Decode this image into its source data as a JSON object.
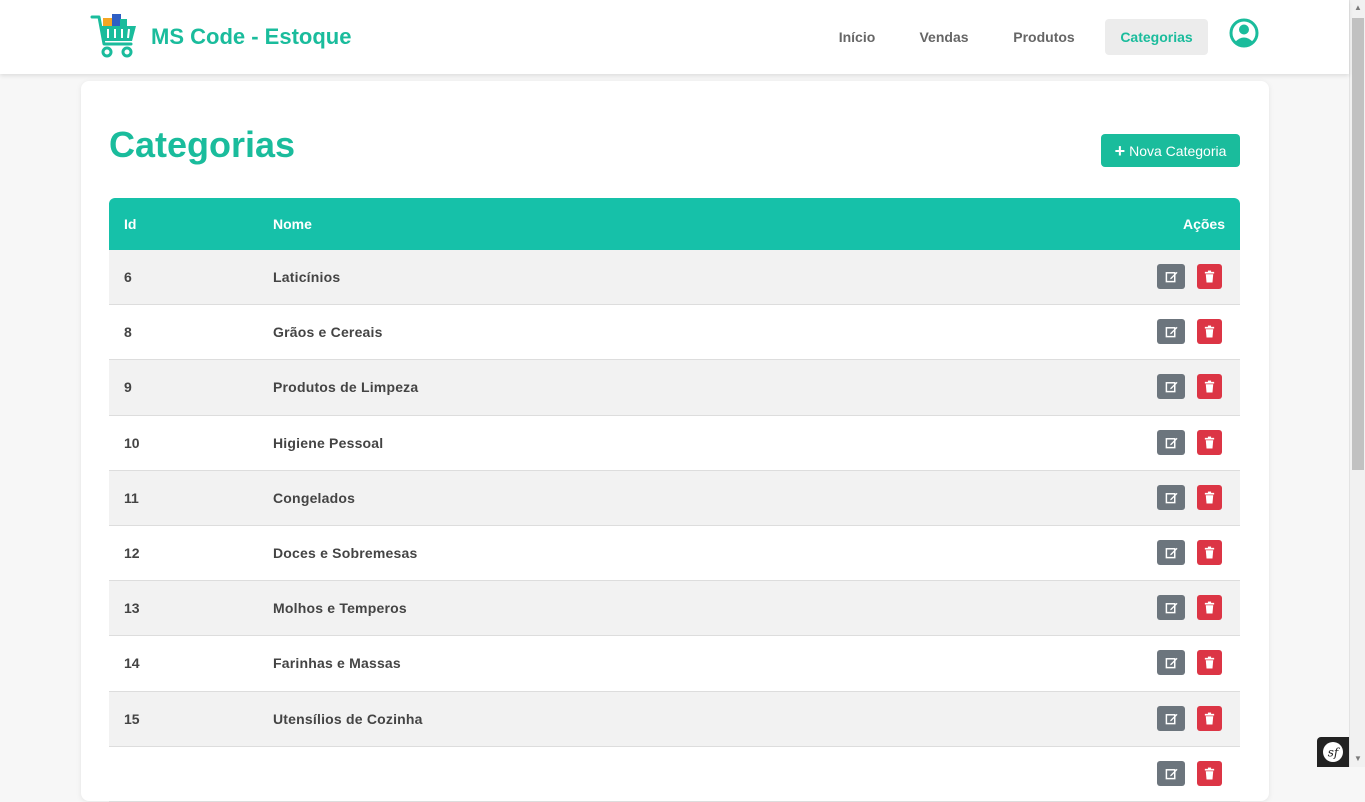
{
  "app": {
    "title": "MS Code - Estoque",
    "brand_color": "#1abc9c"
  },
  "nav": {
    "items": [
      {
        "label": "Início",
        "active": false
      },
      {
        "label": "Vendas",
        "active": false
      },
      {
        "label": "Produtos",
        "active": false
      },
      {
        "label": "Categorias",
        "active": true
      }
    ],
    "user_icon": "user-circle-icon"
  },
  "page": {
    "title": "Categorias",
    "new_button_label": "Nova Categoria",
    "new_button_icon": "plus-icon"
  },
  "table": {
    "header_color": "#16c1a9",
    "columns": [
      "Id",
      "Nome",
      "Ações"
    ],
    "rows": [
      {
        "id": "6",
        "nome": "Laticínios"
      },
      {
        "id": "8",
        "nome": "Grãos e Cereais"
      },
      {
        "id": "9",
        "nome": "Produtos de Limpeza"
      },
      {
        "id": "10",
        "nome": "Higiene Pessoal"
      },
      {
        "id": "11",
        "nome": "Congelados"
      },
      {
        "id": "12",
        "nome": "Doces e Sobremesas"
      },
      {
        "id": "13",
        "nome": "Molhos e Temperos"
      },
      {
        "id": "14",
        "nome": "Farinhas e Massas"
      },
      {
        "id": "15",
        "nome": "Utensílios de Cozinha"
      },
      {
        "id": "",
        "nome": ""
      }
    ],
    "row_actions": {
      "edit_icon": "edit-icon",
      "delete_icon": "trash-icon",
      "edit_color": "#6c757d",
      "delete_color": "#dc3545"
    }
  },
  "debug_toolbar": {
    "icon": "symfony-icon"
  }
}
